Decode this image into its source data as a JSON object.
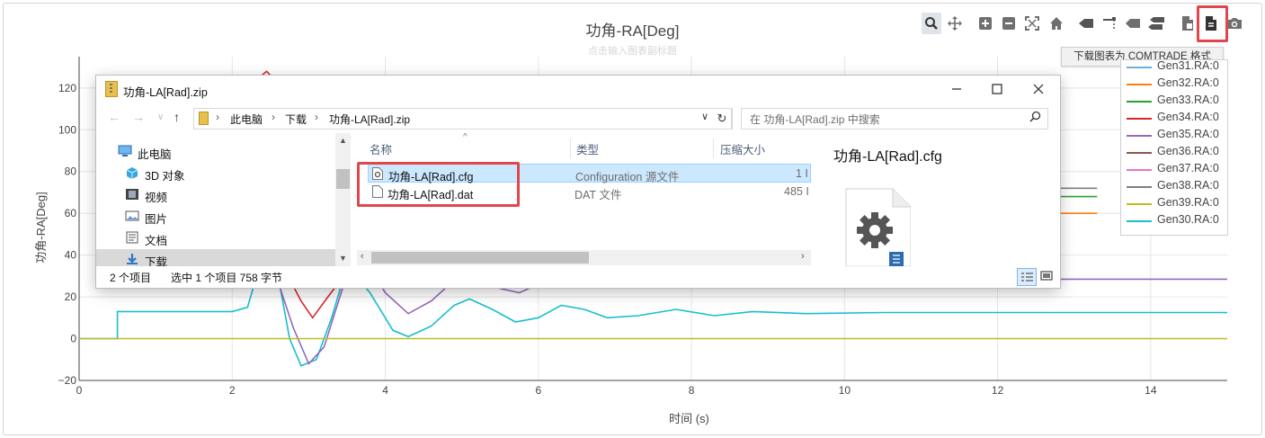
{
  "chart": {
    "title": "功角-RA[Deg]",
    "subtitle": "点击输入图表副标题"
  },
  "modebar": {
    "buttons": [
      "zoom-icon",
      "pan-icon",
      "zoom-in-icon",
      "zoom-out-icon",
      "autoscale-icon",
      "reset-axes-icon",
      "spike-lines-icon",
      "compare-hover-icon",
      "closest-hover-icon",
      "compare-data-icon",
      "download-comtrade-icon",
      "download-cfg-icon",
      "camera-icon"
    ],
    "tooltip": "下载图表为 COMTRADE 格式",
    "highlight_color": "#e0474c"
  },
  "legend": {
    "items": [
      {
        "name": "Gen31.RA:0",
        "color": "#6baed6"
      },
      {
        "name": "Gen32.RA:0",
        "color": "#ff7f0e"
      },
      {
        "name": "Gen33.RA:0",
        "color": "#2ca02c"
      },
      {
        "name": "Gen34.RA:0",
        "color": "#d62728"
      },
      {
        "name": "Gen35.RA:0",
        "color": "#9467bd"
      },
      {
        "name": "Gen36.RA:0",
        "color": "#8c564b"
      },
      {
        "name": "Gen37.RA:0",
        "color": "#e377c2"
      },
      {
        "name": "Gen38.RA:0",
        "color": "#7f7f7f"
      },
      {
        "name": "Gen39.RA:0",
        "color": "#bcbd22"
      },
      {
        "name": "Gen30.RA:0",
        "color": "#17becf"
      }
    ]
  },
  "chart_data": {
    "type": "line",
    "xlabel": "时间 (s)",
    "ylabel": "功角-RA[Deg]",
    "xlim": [
      0,
      15
    ],
    "ylim": [
      -20,
      135
    ],
    "x_ticks": [
      "0",
      "2",
      "4",
      "6",
      "8",
      "10",
      "12",
      "14"
    ],
    "y_ticks": [
      "−20",
      "0",
      "20",
      "40",
      "60",
      "80",
      "100",
      "120"
    ],
    "grid": true,
    "series": [
      {
        "name": "Gen30.RA:0",
        "color": "#17becf",
        "points": [
          [
            0,
            0
          ],
          [
            0.5,
            0
          ],
          [
            0.5,
            13
          ],
          [
            2,
            13
          ],
          [
            2.2,
            15
          ],
          [
            2.4,
            40
          ],
          [
            2.6,
            30
          ],
          [
            2.75,
            0
          ],
          [
            2.9,
            -13
          ],
          [
            3.1,
            -10
          ],
          [
            3.3,
            10
          ],
          [
            3.5,
            35
          ],
          [
            3.8,
            22
          ],
          [
            4.1,
            4
          ],
          [
            4.3,
            1
          ],
          [
            4.6,
            6
          ],
          [
            4.9,
            16
          ],
          [
            5.1,
            19
          ],
          [
            5.4,
            14
          ],
          [
            5.7,
            8
          ],
          [
            6,
            10
          ],
          [
            6.3,
            16
          ],
          [
            6.6,
            14
          ],
          [
            6.9,
            10
          ],
          [
            7.3,
            11
          ],
          [
            7.8,
            14
          ],
          [
            8.3,
            11
          ],
          [
            8.8,
            13
          ],
          [
            9.5,
            12
          ],
          [
            10.5,
            12.5
          ],
          [
            12,
            12.5
          ],
          [
            15,
            12.5
          ]
        ]
      },
      {
        "name": "Gen35.RA:0",
        "color": "#9467bd",
        "points": [
          [
            2.5,
            38
          ],
          [
            2.8,
            5
          ],
          [
            3,
            -12
          ],
          [
            3.2,
            -4
          ],
          [
            3.45,
            25
          ],
          [
            3.7,
            40
          ],
          [
            4,
            22
          ],
          [
            4.3,
            12
          ],
          [
            4.6,
            18
          ],
          [
            4.9,
            28
          ],
          [
            5.2,
            30
          ],
          [
            5.5,
            24
          ],
          [
            5.75,
            22
          ],
          [
            6,
            26
          ],
          [
            6.3,
            30
          ],
          [
            6.7,
            29
          ],
          [
            7.5,
            28
          ],
          [
            9,
            28.5
          ],
          [
            11,
            28.5
          ],
          [
            15,
            28.5
          ]
        ]
      },
      {
        "name": "Gen34.RA:0",
        "color": "#d62728",
        "points": [
          [
            2.7,
            32
          ],
          [
            2.9,
            18
          ],
          [
            3.05,
            10
          ],
          [
            3.25,
            20
          ],
          [
            3.5,
            32
          ]
        ]
      },
      {
        "name": "Gen34.RA:0",
        "color": "#d62728",
        "points": [
          [
            2.35,
            125
          ],
          [
            2.45,
            128
          ],
          [
            2.55,
            124
          ]
        ]
      },
      {
        "name": "Gen39.RA:0",
        "color": "#bcbd22",
        "points": [
          [
            0,
            0
          ],
          [
            15,
            0
          ]
        ]
      },
      {
        "name": "Gen38.RA:0",
        "color": "#7f7f7f",
        "points": [
          [
            12.8,
            72
          ],
          [
            13.3,
            72
          ]
        ]
      },
      {
        "name": "Gen33.RA:0",
        "color": "#2ca02c",
        "points": [
          [
            12.8,
            68
          ],
          [
            13.3,
            68
          ]
        ]
      },
      {
        "name": "Gen32.RA:0",
        "color": "#ff7f0e",
        "points": [
          [
            12.8,
            60
          ],
          [
            13.3,
            60
          ]
        ]
      }
    ]
  },
  "explorer": {
    "title": "功角-LA[Rad].zip",
    "breadcrumbs": [
      "此电脑",
      "下载",
      "功角-LA[Rad].zip"
    ],
    "search_placeholder": "在 功角-LA[Rad].zip 中搜索",
    "nav_items": [
      {
        "label": "此电脑",
        "icon": "pc-icon"
      },
      {
        "label": "3D 对象",
        "icon": "cube-icon"
      },
      {
        "label": "视频",
        "icon": "video-icon"
      },
      {
        "label": "图片",
        "icon": "picture-icon"
      },
      {
        "label": "文档",
        "icon": "document-icon"
      },
      {
        "label": "下载",
        "icon": "download-icon"
      }
    ],
    "columns": [
      "名称",
      "类型",
      "压缩大小"
    ],
    "files": [
      {
        "name": "功角-LA[Rad].cfg",
        "type": "Configuration 源文件",
        "size": "1 I"
      },
      {
        "name": "功角-LA[Rad].dat",
        "type": "DAT 文件",
        "size": "485 I"
      }
    ],
    "preview_name": "功角-LA[Rad].cfg",
    "status": {
      "count": "2 个项目",
      "selection": "选中 1 个项目  758 字节"
    }
  }
}
